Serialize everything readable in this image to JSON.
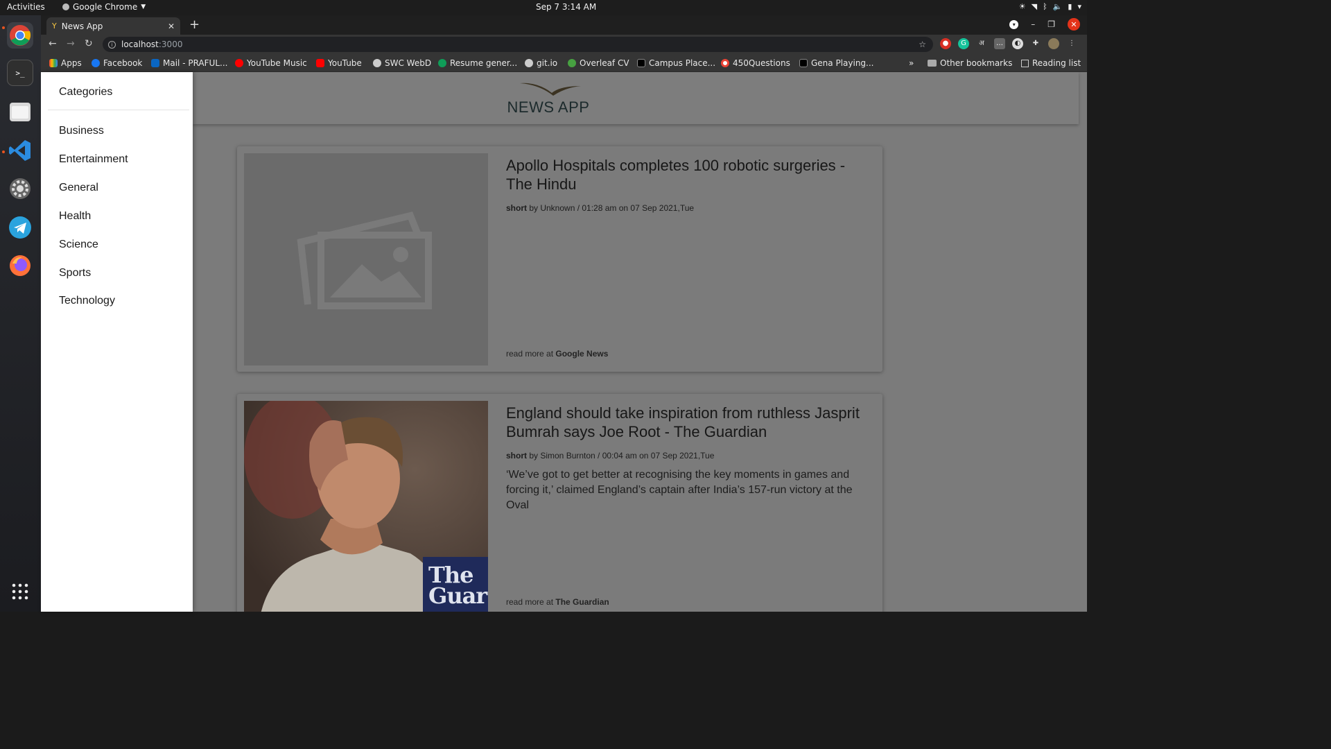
{
  "os": {
    "activities": "Activities",
    "app_name": "Google Chrome",
    "clock": "Sep 7   3:14 AM"
  },
  "browser": {
    "tab_title": "News App",
    "url_host": "localhost",
    "url_port": ":3000",
    "bookmarks": [
      {
        "label": "Apps",
        "color": "#4285f4"
      },
      {
        "label": "Facebook",
        "color": "#1877f2"
      },
      {
        "label": "Mail - PRAFUL...",
        "color": "#0a66c2"
      },
      {
        "label": "YouTube Music",
        "color": "#ff0000"
      },
      {
        "label": "YouTube",
        "color": "#ff0000"
      },
      {
        "label": "SWC WebD",
        "color": "#cccccc"
      },
      {
        "label": "Resume gener...",
        "color": "#0f9d58"
      },
      {
        "label": "git.io",
        "color": "#cccccc"
      },
      {
        "label": "Overleaf CV",
        "color": "#47a141"
      },
      {
        "label": "Campus Place...",
        "color": "#000000"
      },
      {
        "label": "450Questions",
        "color": "#ea4335"
      },
      {
        "label": "Gena Playing...",
        "color": "#000000"
      }
    ],
    "other_bookmarks": "Other bookmarks",
    "reading_list": "Reading list",
    "overflow": "»"
  },
  "app": {
    "logo_text": "NEWS APP",
    "drawer": {
      "title": "Categories",
      "categories": [
        "Business",
        "Entertainment",
        "General",
        "Health",
        "Science",
        "Sports",
        "Technology"
      ]
    },
    "articles": [
      {
        "title": "Apollo Hospitals completes 100 robotic surgeries - The Hindu",
        "tag": "short",
        "byline": " by Unknown / 01:28 am on 07 Sep 2021,Tue",
        "description": "",
        "read_more_prefix": "read more at ",
        "source": "Google News"
      },
      {
        "title": "England should take inspiration from ruthless Jasprit Bumrah says Joe Root - The Guardian",
        "tag": "short",
        "byline": " by Simon Burnton / 00:04 am on 07 Sep 2021,Tue",
        "description": "‘We’ve got to get better at recognising the key moments in games and forcing it,’ claimed England’s captain after India’s 157-run victory at the Oval",
        "read_more_prefix": "read more at ",
        "source": "The Guardian",
        "image_logo_text": "The Guar"
      }
    ]
  }
}
